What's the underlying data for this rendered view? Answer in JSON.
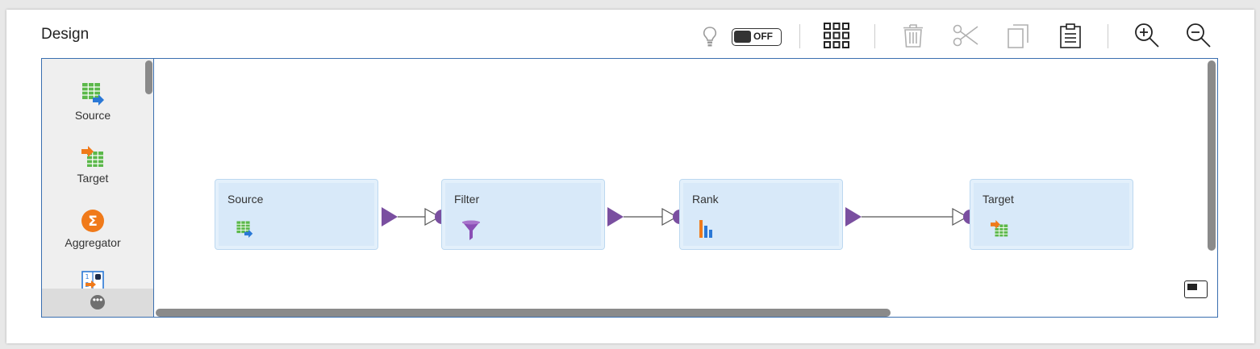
{
  "header": {
    "title": "Design",
    "toggle_label": "OFF"
  },
  "toolbar": {
    "icons": [
      "lightbulb-icon",
      "grid-icon",
      "trash-icon",
      "scissors-icon",
      "copy-icon",
      "clipboard-icon",
      "zoom-in-icon",
      "zoom-out-icon"
    ]
  },
  "palette": {
    "items": [
      {
        "label": "Source",
        "icon": "source-table-icon"
      },
      {
        "label": "Target",
        "icon": "target-table-icon"
      },
      {
        "label": "Aggregator",
        "icon": "sigma-icon"
      },
      {
        "label": "",
        "icon": "sequence-icon"
      }
    ],
    "more_label": "•••"
  },
  "canvas": {
    "nodes": [
      {
        "title": "Source",
        "icon": "source-table-icon"
      },
      {
        "title": "Filter",
        "icon": "funnel-icon"
      },
      {
        "title": "Rank",
        "icon": "bar-chart-icon"
      },
      {
        "title": "Target",
        "icon": "target-table-icon"
      }
    ]
  },
  "colors": {
    "accent": "#7a4fa0",
    "node_bg": "#d8e9f9",
    "border": "#3a6fb0",
    "green": "#5bb84a",
    "blue": "#2a78d6",
    "orange": "#f07a1a"
  }
}
